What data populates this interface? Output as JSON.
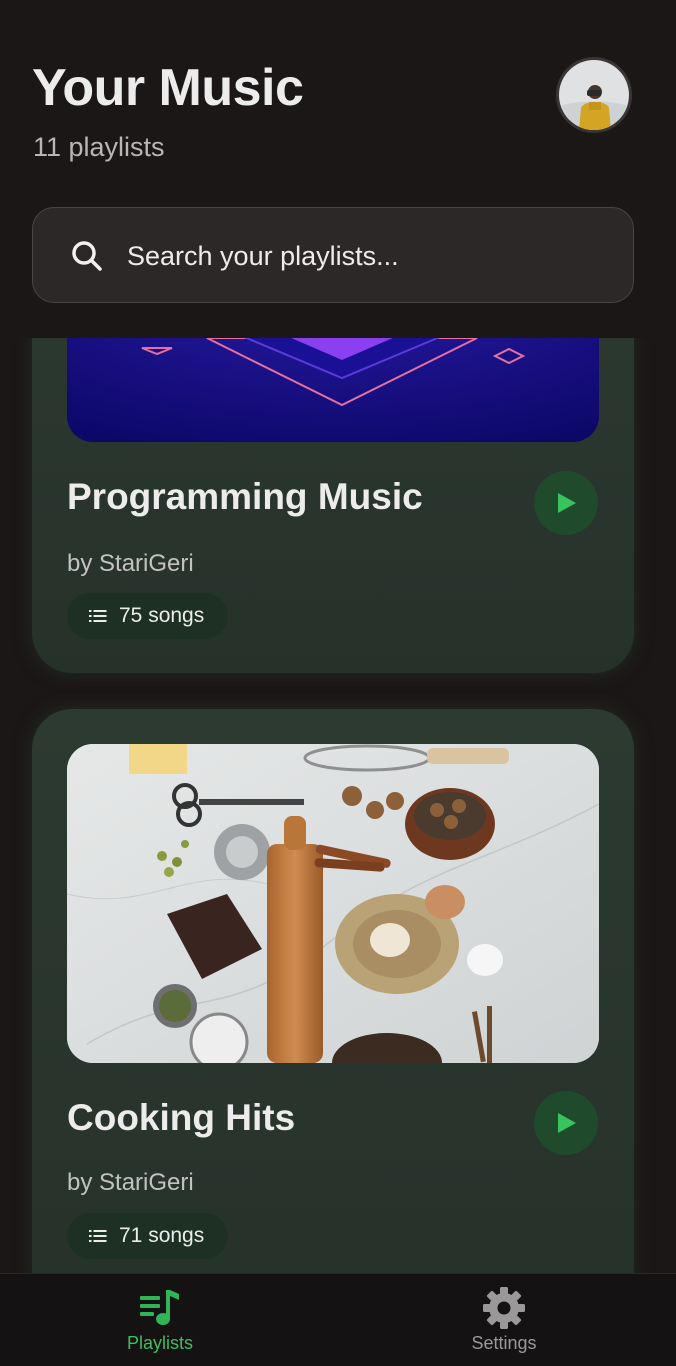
{
  "header": {
    "title": "Your Music",
    "subtitle": "11 playlists",
    "avatar_icon": "user-avatar"
  },
  "search": {
    "placeholder": "Search your playlists...",
    "value": "",
    "icon": "search-icon"
  },
  "playlists": [
    {
      "title": "Programming Music",
      "owner": "by StariGeri",
      "songs": "75 songs",
      "cover": "abstract purple neon diamond art"
    },
    {
      "title": "Cooking Hits",
      "owner": "by StariGeri",
      "songs": "71 songs",
      "cover": "baking ingredients on marble"
    }
  ],
  "nav": {
    "items": [
      {
        "label": "Playlists",
        "icon": "music-list-icon",
        "active": true
      },
      {
        "label": "Settings",
        "icon": "gear-icon",
        "active": false
      }
    ]
  },
  "colors": {
    "accent": "#3fbf5e",
    "background": "#1b1717",
    "card": "#2b3830",
    "pill": "#1e3023",
    "play_button": "#1f4a2c"
  }
}
